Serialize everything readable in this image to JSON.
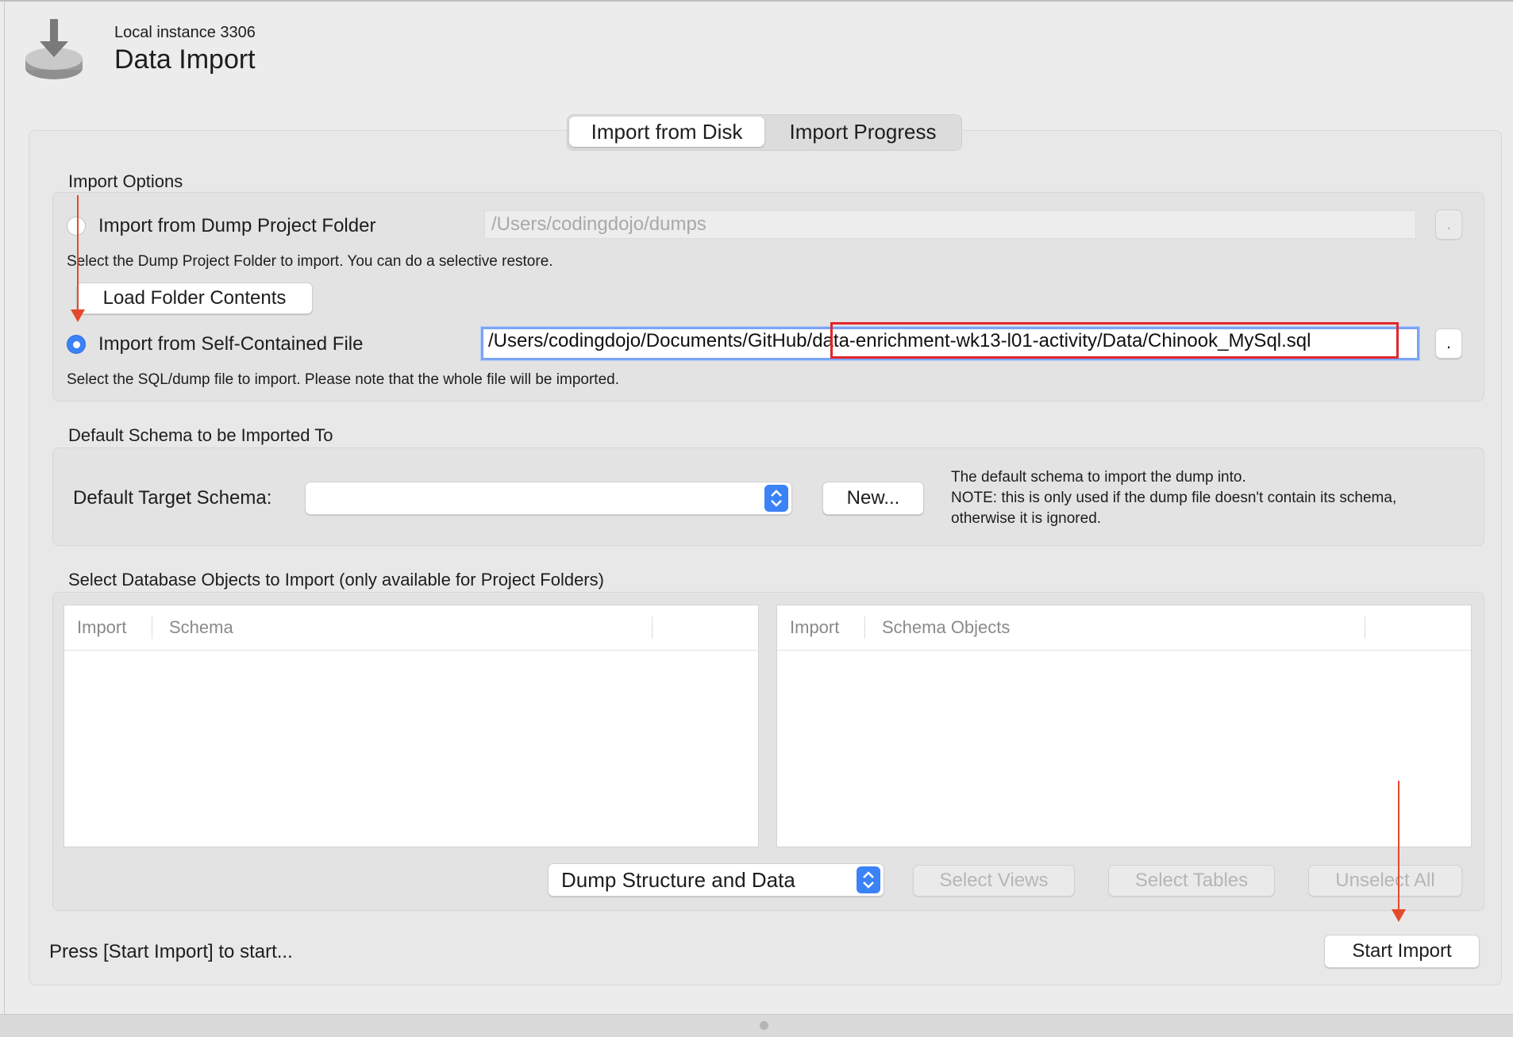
{
  "header": {
    "instance": "Local instance 3306",
    "title": "Data Import"
  },
  "tabs": [
    {
      "label": "Import from Disk",
      "active": true
    },
    {
      "label": "Import Progress",
      "active": false
    }
  ],
  "import_options": {
    "section_label": "Import Options",
    "dump_folder": {
      "label": "Import from Dump Project Folder",
      "path": "/Users/codingdojo/dumps",
      "selected": false,
      "help": "Select the Dump Project Folder to import. You can do a selective restore.",
      "browse_label": ".",
      "load_button": "Load Folder Contents"
    },
    "self_contained": {
      "label": "Import from Self-Contained File",
      "path_part1": "/Users/codingdojo/Documents/GitHub",
      "path_part2": "/data-enrichment-wk13-l01-activity/Data/Chinook_MySql.sql",
      "selected": true,
      "help": "Select the SQL/dump file to import. Please note that the whole file will be imported.",
      "browse_label": "."
    }
  },
  "default_schema": {
    "section_label": "Default Schema to be Imported To",
    "field_label": "Default Target Schema:",
    "selected_value": "",
    "new_button": "New...",
    "note_line1": "The default schema to import the dump into.",
    "note_line2": "NOTE: this is only used if the dump file doesn't contain its schema,",
    "note_line3": "otherwise it is ignored."
  },
  "objects": {
    "section_label": "Select Database Objects to Import (only available for Project Folders)",
    "left_table": {
      "col1": "Import",
      "col2": "Schema"
    },
    "right_table": {
      "col1": "Import",
      "col2": "Schema Objects"
    },
    "dump_mode": "Dump Structure and Data",
    "select_views": "Select Views",
    "select_tables": "Select Tables",
    "unselect_all": "Unselect All"
  },
  "footer": {
    "status": "Press [Start Import] to start...",
    "start_button": "Start Import"
  },
  "colors": {
    "accent": "#3b82f6",
    "annotation_red": "#e24a2e"
  }
}
